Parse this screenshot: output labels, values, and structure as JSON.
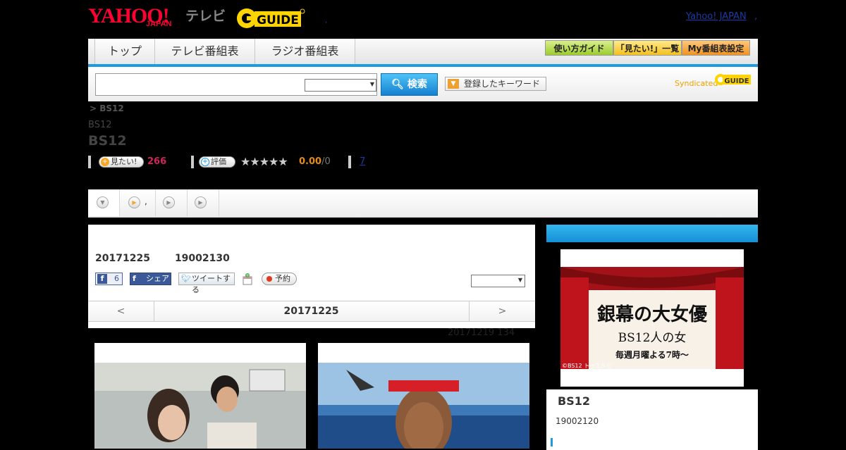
{
  "header": {
    "yahoo_logo": "YAHOO!",
    "yahoo_sub": "JAPAN",
    "tv_label": "テレビ",
    "gguide_logo": "GUIDE",
    "dot": ",",
    "yahoo_japan_link": "Yahoo! JAPAN",
    "link_sep": ","
  },
  "nav": {
    "tabs": [
      "トップ",
      "テレビ番組表",
      "ラジオ番組表"
    ],
    "buttons": [
      "使い方ガイド",
      "「見たい!」一覧",
      "My番組表設定"
    ]
  },
  "search": {
    "placeholder": "",
    "select_value": "",
    "button_label": "検索",
    "keyword_button": "登録したキーワード",
    "syndicated": "Syndicated"
  },
  "program": {
    "breadcrumb": "> BS12",
    "channel_small": "BS12",
    "channel_title": "BS12",
    "want_label": "見たい!",
    "want_count": "266",
    "rate_label": "評価",
    "stars": "★★★★★",
    "score": "0.00",
    "score_den": "/0",
    "link_7": "7"
  },
  "subtabs": [
    {
      "label": "",
      "icon": "chevron-down-icon"
    },
    {
      "label": ",",
      "icon": "play-icon"
    },
    {
      "label": "",
      "icon": "play-icon"
    },
    {
      "label": "",
      "icon": "play-icon"
    }
  ],
  "main": {
    "date": "20171225",
    "time": "19002130",
    "fb_like_count": "6",
    "fb_share": "シェア",
    "tweet": "ツイートする",
    "reserve": "予約",
    "select_value": "",
    "prev": "<",
    "day": "20171225",
    "next": ">",
    "updated": "20171219  134"
  },
  "side": {
    "banner_title": "銀幕の大女優",
    "banner_sub": "BS12人の女",
    "banner_time": "毎週月曜よる7時〜",
    "banner_credit": "©BS12 トゥエルビ",
    "title": "BS12",
    "time": "19002120"
  },
  "colors": {
    "accent": "#1e9be0",
    "red": "#d0245b",
    "orange": "#e38a1d"
  }
}
